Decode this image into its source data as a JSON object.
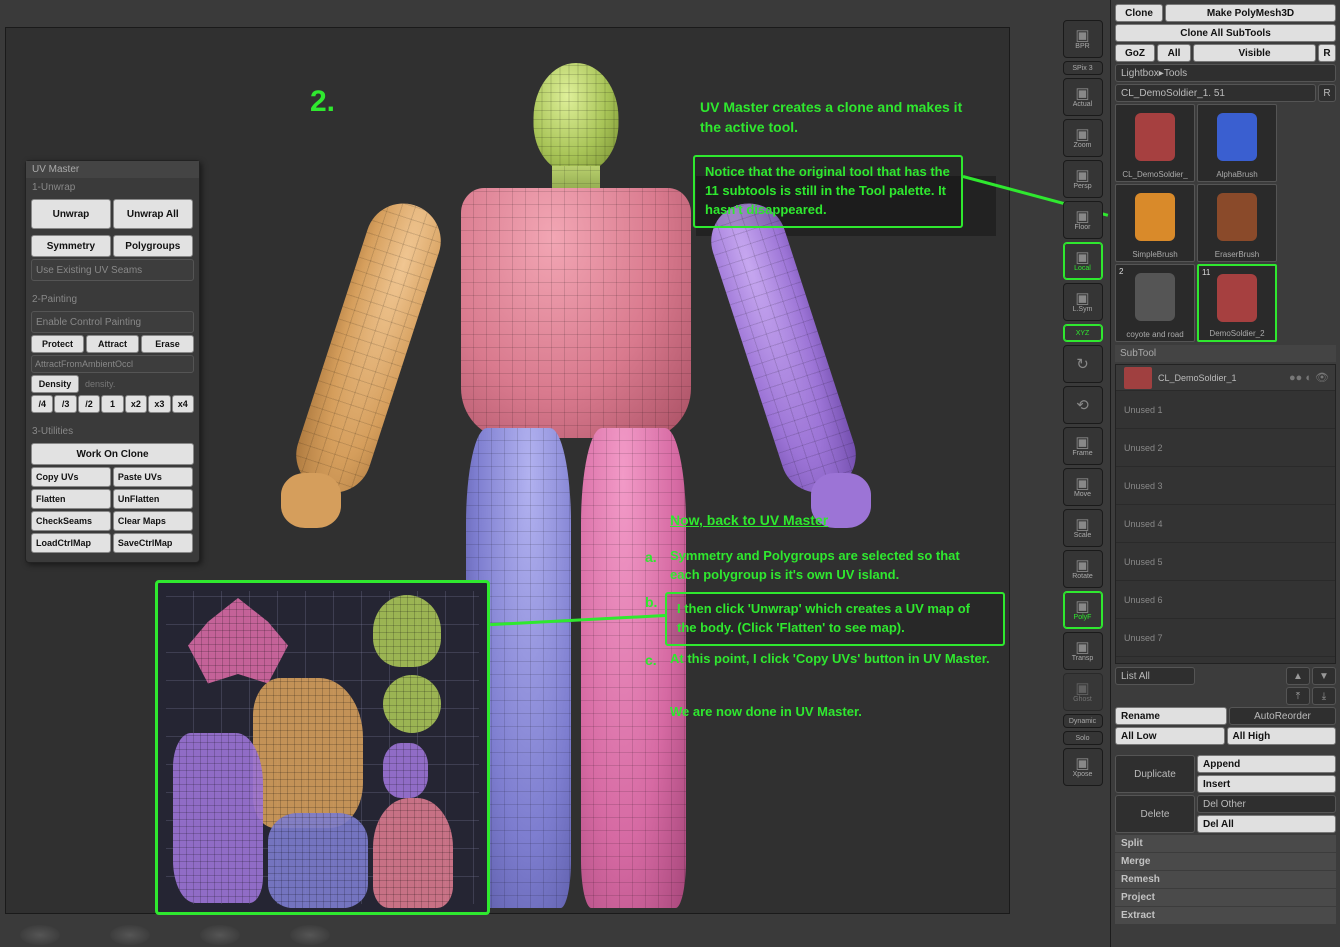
{
  "step_number": "2.",
  "annotations": {
    "top_note": "UV Master  creates a clone and makes it the active tool.",
    "notice_box": "Notice that the original tool that has the 11 subtools is still in the Tool palette. It hasn't disappeared.",
    "back_header": "Now, back to UV Master",
    "a_label": "a.",
    "a_text": "Symmetry and Polygroups are selected so that each polygroup is it's own UV island.",
    "b_label": "b.",
    "b_box": "I then click 'Unwrap' which creates a UV map of the body. (Click 'Flatten' to see map).",
    "c_label": "c.",
    "c_text": "At this point, I click 'Copy UVs' button in UV Master.",
    "done_text": "We are now done in UV Master."
  },
  "uvmaster": {
    "title": "UV Master",
    "s1": "1-Unwrap",
    "unwrap": "Unwrap",
    "unwrap_all": "Unwrap All",
    "symmetry": "Symmetry",
    "polygroups": "Polygroups",
    "use_seams": "Use Existing UV Seams",
    "s2": "2-Painting",
    "ecp": "Enable Control Painting",
    "protect": "Protect",
    "attract": "Attract",
    "erase": "Erase",
    "ao": "AttractFromAmbientOccl",
    "density": "Density",
    "density_lbl": "density.",
    "d_btns": [
      "/4",
      "/3",
      "/2",
      "1",
      "x2",
      "x3",
      "x4"
    ],
    "s3": "3-Utilities",
    "work_clone": "Work On Clone",
    "copy_uvs": "Copy UVs",
    "paste_uvs": "Paste UVs",
    "flatten": "Flatten",
    "unflatten": "UnFlatten",
    "checkseams": "CheckSeams",
    "clearmaps": "Clear Maps",
    "loadmap": "LoadCtrlMap",
    "savemap": "SaveCtrlMap"
  },
  "right_sidebar": [
    {
      "label": "BPR",
      "active": false
    },
    {
      "label": "SPix 3",
      "active": false,
      "flat": true
    },
    {
      "label": "Actual",
      "active": false
    },
    {
      "label": "Zoom",
      "active": false
    },
    {
      "label": "Persp",
      "active": false
    },
    {
      "label": "Floor",
      "active": false
    },
    {
      "label": "Local",
      "active": true
    },
    {
      "label": "L.Sym",
      "active": false
    },
    {
      "label": "XYZ",
      "active": true,
      "thin": true
    },
    {
      "label": "",
      "active": false,
      "icon": "↻"
    },
    {
      "label": "",
      "active": false,
      "icon": "⟲"
    },
    {
      "label": "Frame",
      "active": false
    },
    {
      "label": "Move",
      "active": false
    },
    {
      "label": "Scale",
      "active": false
    },
    {
      "label": "Rotate",
      "active": false
    },
    {
      "label": "PolyF",
      "active": true
    },
    {
      "label": "Transp",
      "active": false
    },
    {
      "label": "Ghost",
      "active": false,
      "dis": true
    },
    {
      "label": "Dynamic",
      "active": false,
      "flat": true
    },
    {
      "label": "Solo",
      "active": false,
      "flat": true
    },
    {
      "label": "Xpose",
      "active": false
    }
  ],
  "panel": {
    "clone": "Clone",
    "make_poly": "Make PolyMesh3D",
    "clone_all": "Clone All SubTools",
    "goz": "GoZ",
    "all": "All",
    "visible": "Visible",
    "r": "R",
    "lightbox": "Lightbox▸Tools",
    "tool_name": "CL_DemoSoldier_1. 51",
    "thumbs": [
      {
        "label": "CL_DemoSoldier_",
        "color": "#a64040"
      },
      {
        "label": "AlphaBrush",
        "color": "#3a5fd0"
      },
      {
        "label": "SimpleBrush",
        "color": "#d98a2a"
      },
      {
        "label": "EraserBrush",
        "color": "#8a4a2a"
      },
      {
        "label": "coyote and road",
        "color": "#555",
        "badge": "2"
      },
      {
        "label": "DemoSoldier_2",
        "color": "#a64040",
        "sel": true,
        "badge": "11"
      }
    ],
    "subtool_hdr": "SubTool",
    "active_sub": "CL_DemoSoldier_1",
    "unused": [
      "Unused 1",
      "Unused 2",
      "Unused 3",
      "Unused 4",
      "Unused 5",
      "Unused 6",
      "Unused 7"
    ],
    "list_all": "List All",
    "rename": "Rename",
    "autoreorder": "AutoReorder",
    "all_low": "All Low",
    "all_high": "All High",
    "duplicate": "Duplicate",
    "append": "Append",
    "insert": "Insert",
    "delete": "Delete",
    "del_other": "Del Other",
    "del_all": "Del All",
    "sections": [
      "Split",
      "Merge",
      "Remesh",
      "Project",
      "Extract"
    ]
  }
}
